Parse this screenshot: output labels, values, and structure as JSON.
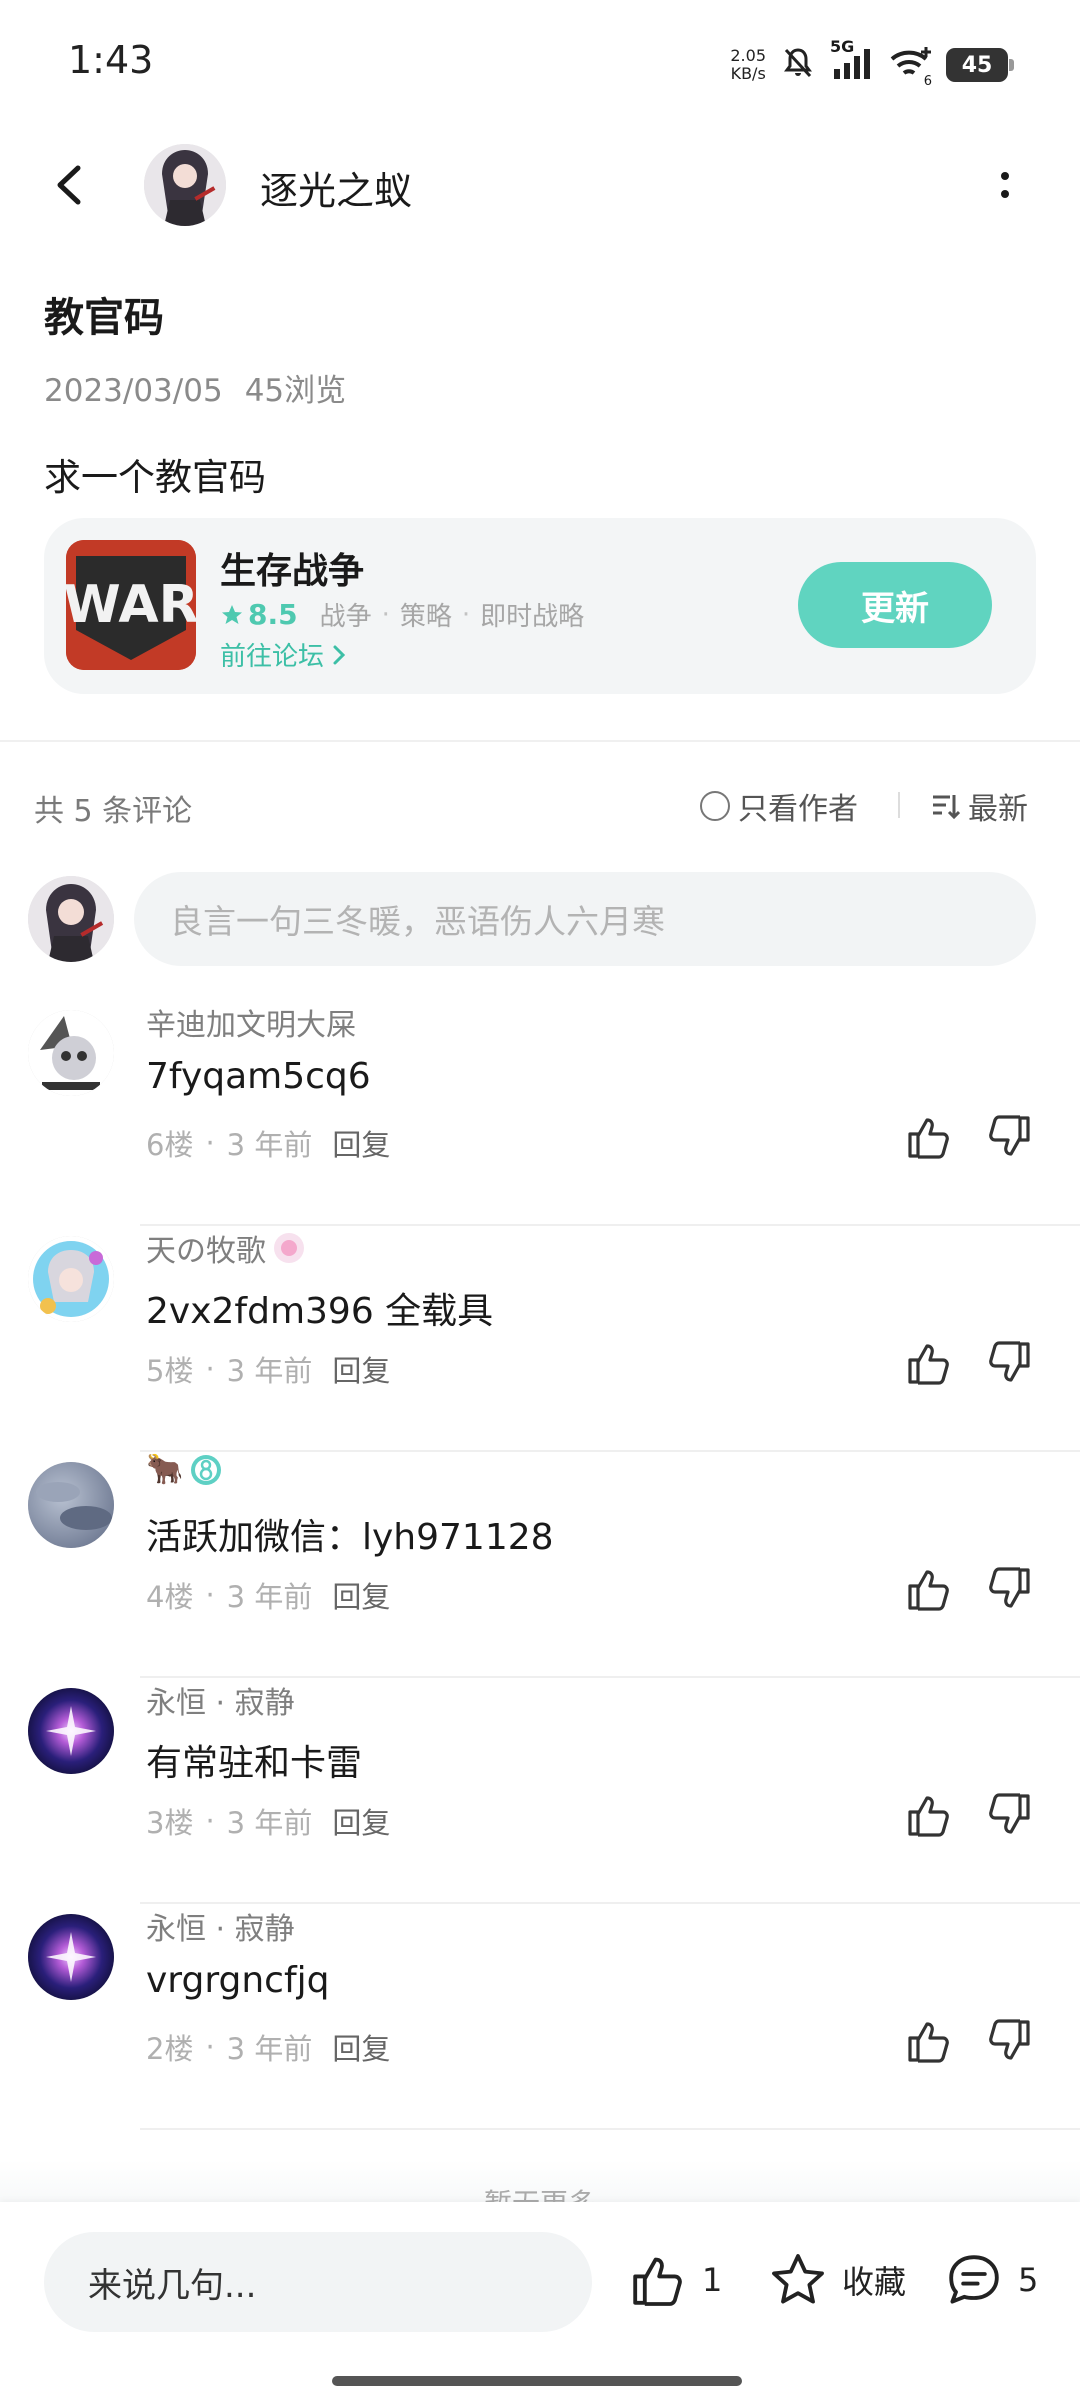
{
  "status_bar": {
    "time": "1:43",
    "net_speed_value": "2.05",
    "net_speed_unit": "KB/s",
    "network": "5G",
    "wifi_sub": "6",
    "battery": "45"
  },
  "header": {
    "author_name": "逐光之蚁"
  },
  "post": {
    "title": "教官码",
    "date": "2023/03/05",
    "views": "45浏览",
    "body": "求一个教官码"
  },
  "game_card": {
    "name": "生存战争",
    "score": "8.5",
    "tags": [
      "战争",
      "策略",
      "即时战略"
    ],
    "forum_link": "前往论坛",
    "update_button": "更新",
    "logo_text": "WAR"
  },
  "comments_header": {
    "count_label": "共 5 条评论",
    "only_author": "只看作者",
    "sort": "最新"
  },
  "comment_input": {
    "placeholder": "良言一句三冬暖，恶语伤人六月寒"
  },
  "comments": [
    {
      "user": "辛迪加文明大屎",
      "text": "7fyqam5cq6",
      "floor": "6楼",
      "time": "3 年前",
      "reply": "回复"
    },
    {
      "user": "天の牧歌",
      "text": "2vx2fdm396 全载具",
      "floor": "5楼",
      "time": "3 年前",
      "reply": "回复"
    },
    {
      "user": "🐂",
      "text": "活跃加微信：lyh971128",
      "floor": "4楼",
      "time": "3 年前",
      "reply": "回复"
    },
    {
      "user": "永恒 · 寂静",
      "text": "有常驻和卡雷",
      "floor": "3楼",
      "time": "3 年前",
      "reply": "回复"
    },
    {
      "user": "永恒 · 寂静",
      "text": "vrgrgncfjq",
      "floor": "2楼",
      "time": "3 年前",
      "reply": "回复"
    }
  ],
  "load_more": "暂无更多",
  "bottom_bar": {
    "input_placeholder": "来说几句...",
    "like_count": "1",
    "favorite_label": "收藏",
    "comment_count": "5"
  },
  "colors": {
    "accent": "#60d4c0",
    "accent_text": "#3cbfa6",
    "game_logo_bg": "#c23a26"
  }
}
